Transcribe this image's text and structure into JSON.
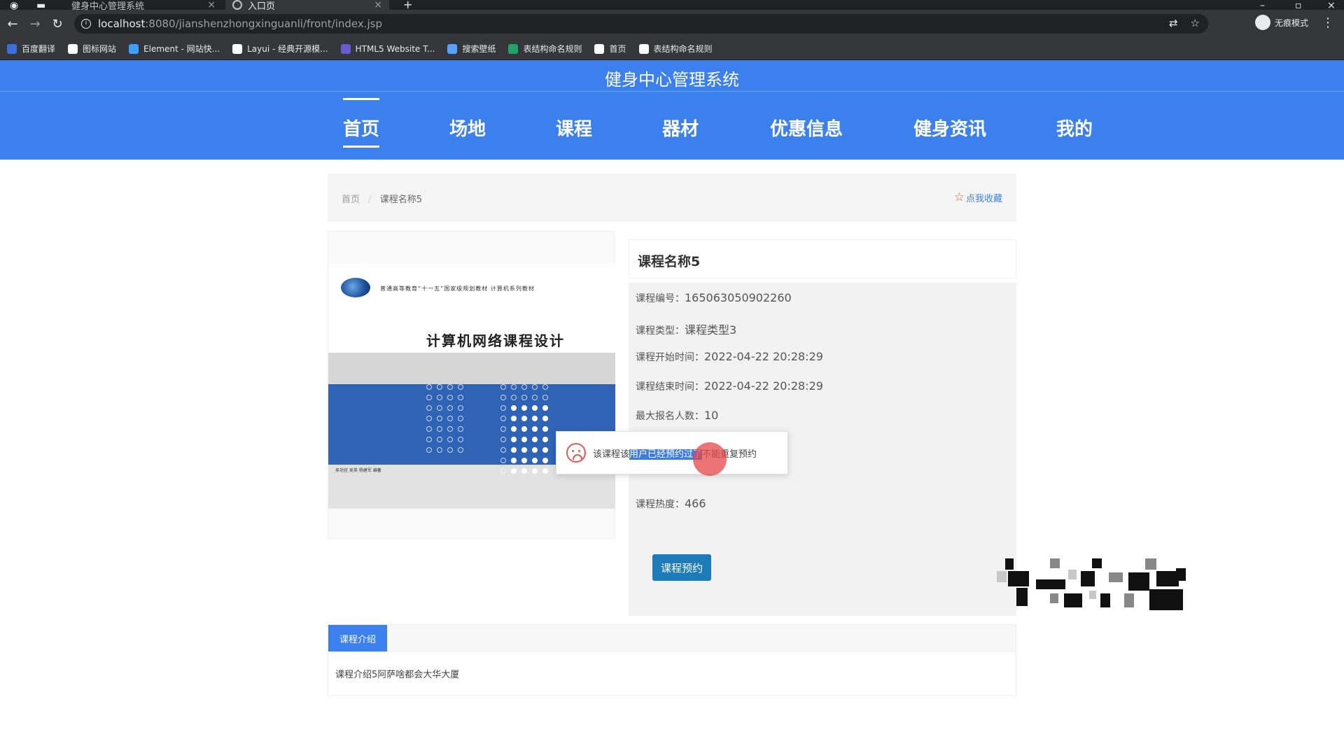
{
  "browser": {
    "tabs": [
      {
        "title": "健身中心管理系统",
        "active": false
      },
      {
        "title": "入口页",
        "active": true
      }
    ],
    "url_host": "localhost",
    "url_path": ":8080/jianshenzhongxinguanli/front/index.jsp",
    "profile_label": "无痕模式",
    "bookmarks": [
      {
        "label": "百度翻译",
        "icon": "translate-icon",
        "color": "#3b6fe0"
      },
      {
        "label": "图标网站",
        "icon": "flag-icon",
        "color": "#ffffff"
      },
      {
        "label": "Element - 网站快...",
        "icon": "element-icon",
        "color": "#409eff"
      },
      {
        "label": "Layui - 经典开源模...",
        "icon": "layui-icon",
        "color": "#ffffff"
      },
      {
        "label": "HTML5 Website T...",
        "icon": "html5-icon",
        "color": "#6a5acd"
      },
      {
        "label": "搜索壁纸",
        "icon": "wallpaper-icon",
        "color": "#5aa0ff"
      },
      {
        "label": "表结构命名规则",
        "icon": "sheet-icon",
        "color": "#21a366"
      },
      {
        "label": "首页",
        "icon": "globe-icon",
        "color": "#ffffff"
      },
      {
        "label": "表结构命名规则",
        "icon": "globe-icon",
        "color": "#ffffff"
      }
    ]
  },
  "site": {
    "title": "健身中心管理系统",
    "nav": [
      "首页",
      "场地",
      "课程",
      "器材",
      "优惠信息",
      "健身资讯",
      "我的"
    ],
    "active_nav": 0,
    "accent": "#3b80ec"
  },
  "breadcrumb": {
    "home": "首页",
    "separator": "/",
    "current": "课程名称5",
    "favorite_label": "点我收藏"
  },
  "cover": {
    "subtitle": "普通高等教育“十一五”国家级规划教材  计算机系列教材",
    "title": "计算机网络课程设计",
    "authors": "吴功宜  吴英  杨建军  编著"
  },
  "course": {
    "name": "课程名称5",
    "fields": [
      {
        "label": "课程编号：",
        "value": "165063050902260"
      },
      {
        "label": "课程类型：",
        "value": "课程类型3"
      },
      {
        "label": "课程开始时间：",
        "value": "2022-04-22 20:28:29"
      },
      {
        "label": "课程结束时间：",
        "value": "2022-04-22 20:28:29"
      },
      {
        "label": "最大报名人数：",
        "value": "10"
      },
      {
        "label": "课程热度：",
        "value": "466"
      }
    ],
    "book_button": "课程预约"
  },
  "toast": {
    "prefix": "该课程该",
    "selected": "用户已经预约过了",
    "suffix": "不能重复预约"
  },
  "intro": {
    "tab_label": "课程介绍",
    "content": "课程介绍5阿萨啥都会大华大厦"
  }
}
